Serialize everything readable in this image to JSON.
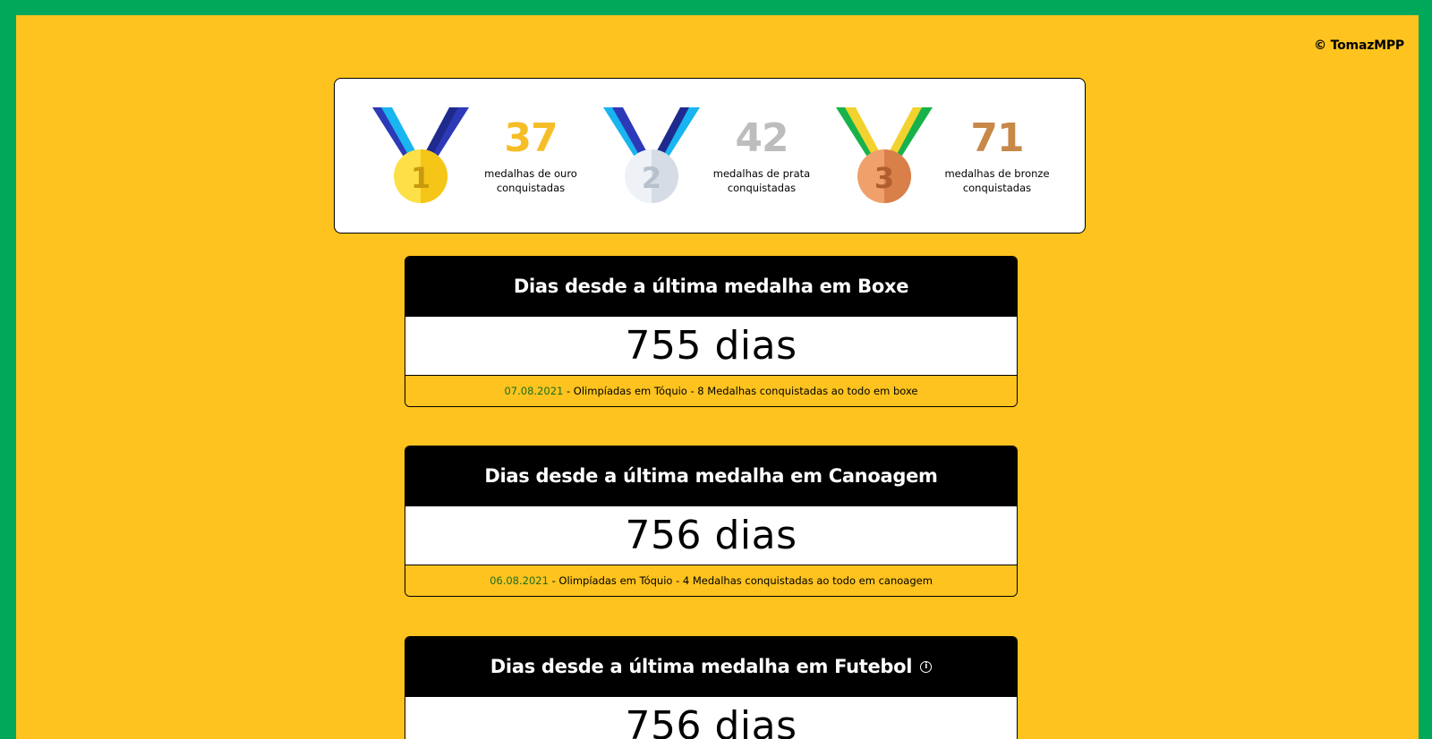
{
  "copyright": "© TomazMPP",
  "colors": {
    "border_green": "#00A859",
    "background_yellow": "#FEC31E",
    "gold": "#F6BE26",
    "silver": "#BDBDBD",
    "bronze": "#C78848",
    "date_green": "#1a6e21"
  },
  "medals": [
    {
      "icon": "gold-medal-icon",
      "number": "1",
      "count": "37",
      "label": "medalhas de ouro conquistadas"
    },
    {
      "icon": "silver-medal-icon",
      "number": "2",
      "count": "42",
      "label": "medalhas de prata conquistadas"
    },
    {
      "icon": "bronze-medal-icon",
      "number": "3",
      "count": "71",
      "label": "medalhas de bronze conquistadas"
    }
  ],
  "cards": [
    {
      "title": "Dias desde a última medalha em Boxe",
      "value": "755 dias",
      "date": "07.08.2021",
      "description": " - Olimpíadas em Tóquio - 8 Medalhas conquistadas ao todo em boxe"
    },
    {
      "title": "Dias desde a última medalha em Canoagem",
      "value": "756 dias",
      "date": "06.08.2021",
      "description": " - Olimpíadas em Tóquio - 4 Medalhas conquistadas ao todo em canoagem"
    },
    {
      "title": "Dias desde a última medalha em Futebol",
      "info_icon": "info-icon",
      "value": "756 dias"
    }
  ]
}
